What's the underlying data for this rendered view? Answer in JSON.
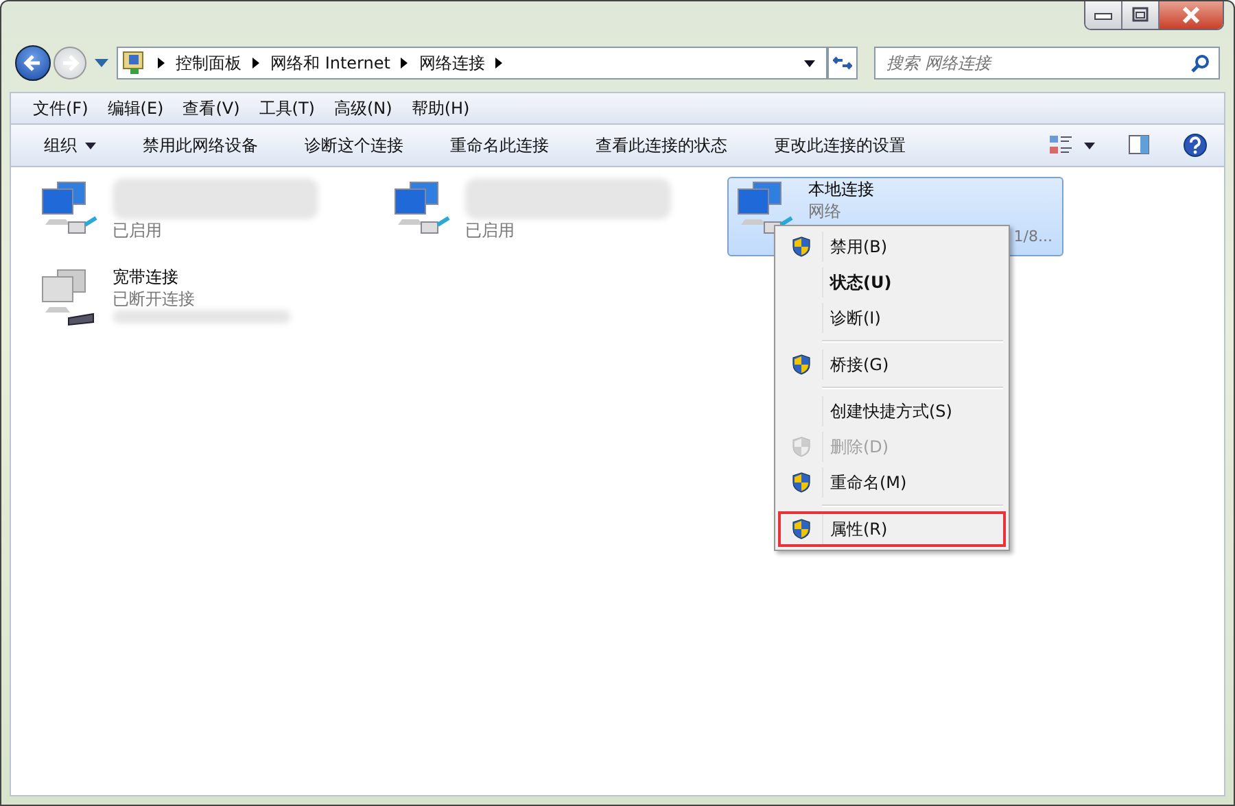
{
  "address_bar": {
    "crumbs": [
      "控制面板",
      "网络和 Internet",
      "网络连接"
    ]
  },
  "search": {
    "placeholder": "搜索 网络连接"
  },
  "menu_bar": [
    "文件(F)",
    "编辑(E)",
    "查看(V)",
    "工具(T)",
    "高级(N)",
    "帮助(H)"
  ],
  "command_bar": {
    "organize": "组织",
    "commands": [
      "禁用此网络设备",
      "诊断这个连接",
      "重命名此连接",
      "查看此连接的状态",
      "更改此连接的设置"
    ]
  },
  "connections": [
    {
      "kind": "ethernet",
      "status": "已启用",
      "selected": false
    },
    {
      "kind": "ethernet",
      "status": "已启用",
      "selected": false
    },
    {
      "kind": "ethernet",
      "name": "本地连接",
      "status": "网络",
      "detail": "1/8...",
      "selected": true
    },
    {
      "kind": "broadband",
      "name": "宽带连接",
      "status": "已断开连接",
      "selected": false
    }
  ],
  "context_menu": {
    "groups": [
      [
        {
          "label": "禁用(B)",
          "shield": true,
          "default": false,
          "disabled": false,
          "selected": false
        },
        {
          "label": "状态(U)",
          "shield": false,
          "default": true,
          "disabled": false,
          "selected": false
        },
        {
          "label": "诊断(I)",
          "shield": false,
          "default": false,
          "disabled": false,
          "selected": false
        }
      ],
      [
        {
          "label": "桥接(G)",
          "shield": true,
          "default": false,
          "disabled": false,
          "selected": false
        }
      ],
      [
        {
          "label": "创建快捷方式(S)",
          "shield": false,
          "default": false,
          "disabled": false,
          "selected": false
        },
        {
          "label": "删除(D)",
          "shield": true,
          "default": false,
          "disabled": true,
          "selected": false
        },
        {
          "label": "重命名(M)",
          "shield": true,
          "default": false,
          "disabled": false,
          "selected": false
        }
      ],
      [
        {
          "label": "属性(R)",
          "shield": true,
          "default": false,
          "disabled": false,
          "selected": true
        }
      ]
    ]
  }
}
